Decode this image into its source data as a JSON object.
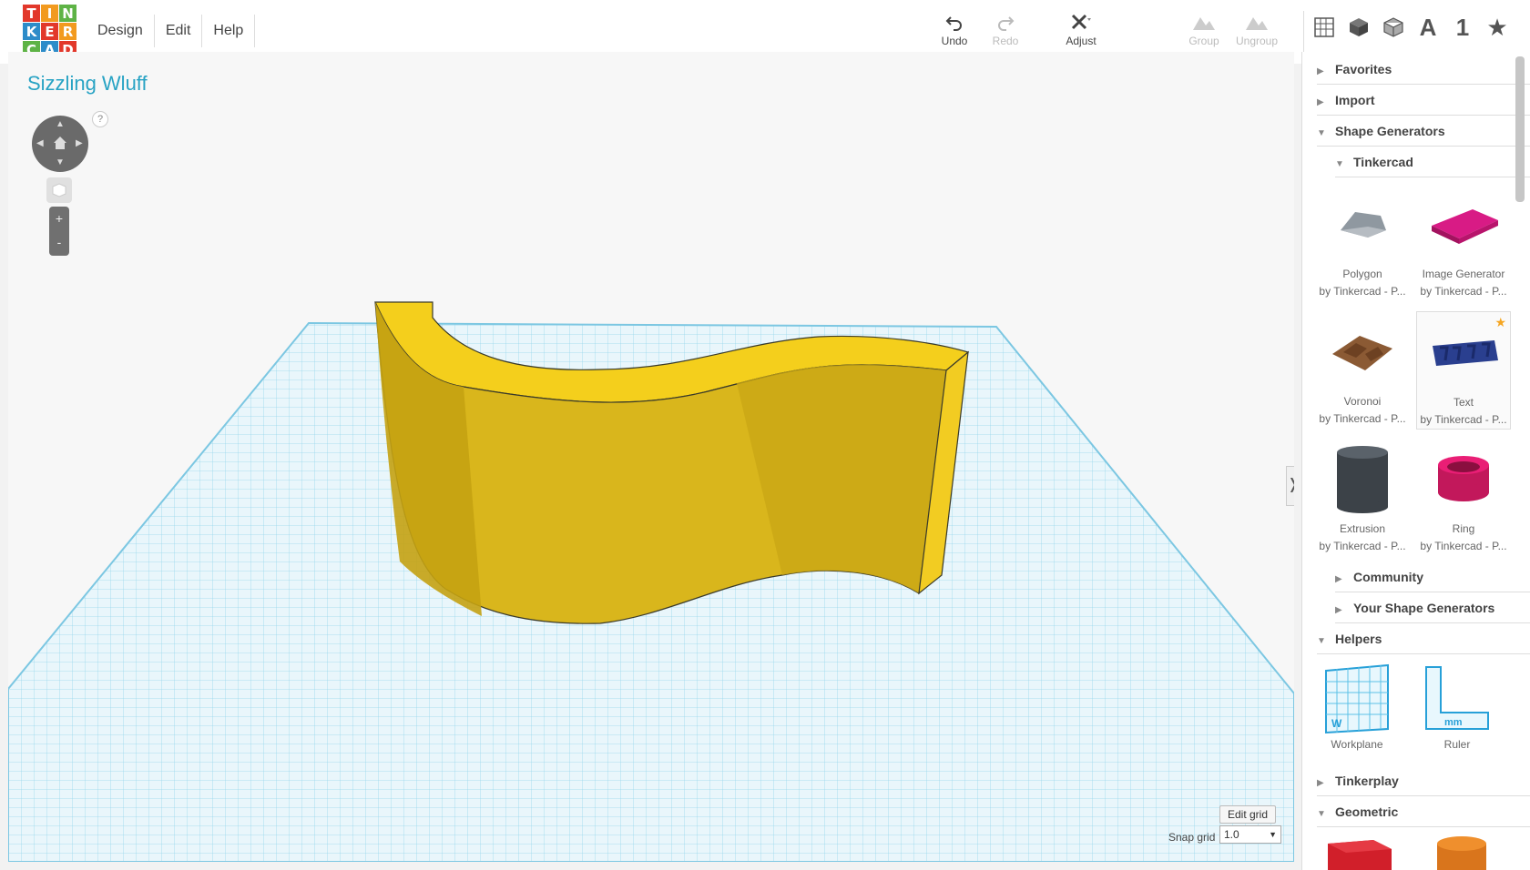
{
  "logo": {
    "letters": [
      "T",
      "I",
      "N",
      "K",
      "E",
      "R",
      "C",
      "A",
      "D"
    ]
  },
  "menu": {
    "design": "Design",
    "edit": "Edit",
    "help": "Help"
  },
  "toolbar": {
    "undo": "Undo",
    "redo": "Redo",
    "adjust": "Adjust",
    "group": "Group",
    "ungroup": "Ungroup"
  },
  "views": {
    "text_a": "A",
    "text_1": "1",
    "star": "★"
  },
  "canvas": {
    "title": "Sizzling Wluff",
    "help": "?",
    "zoom_in": "+",
    "zoom_out": "-",
    "collapse": "❭",
    "edit_grid": "Edit grid",
    "snap_label": "Snap grid",
    "snap_value": "1.0"
  },
  "panel": {
    "favorites": "Favorites",
    "import": "Import",
    "shape_generators": "Shape Generators",
    "tinkercad": "Tinkercad",
    "community": "Community",
    "your_generators": "Your Shape Generators",
    "helpers": "Helpers",
    "tinkerplay": "Tinkerplay",
    "geometric": "Geometric",
    "tiles": [
      {
        "name": "Polygon",
        "by": "by Tinkercad - P..."
      },
      {
        "name": "Image Generator",
        "by": "by Tinkercad - P..."
      },
      {
        "name": "Voronoi",
        "by": "by Tinkercad - P..."
      },
      {
        "name": "Text",
        "by": "by Tinkercad - P..."
      },
      {
        "name": "Extrusion",
        "by": "by Tinkercad - P..."
      },
      {
        "name": "Ring",
        "by": "by Tinkercad - P..."
      }
    ],
    "helper_tiles": [
      {
        "name": "Workplane"
      },
      {
        "name": "Ruler"
      }
    ]
  },
  "colors": {
    "accent": "#28a3c4",
    "shape": "#e6c619",
    "grid": "#8fd3ea"
  }
}
